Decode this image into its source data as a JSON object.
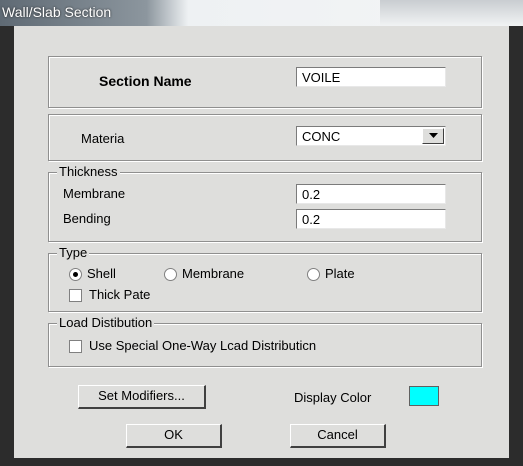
{
  "window": {
    "title": "Wall/Slab Section"
  },
  "section_name": {
    "label": "Section Name",
    "value": "VOILE"
  },
  "material": {
    "label": "Materia",
    "value": "CONC"
  },
  "thickness": {
    "group_label": "Thickness",
    "membrane_label": "Membrane",
    "membrane_value": "0.2",
    "bending_label": "Bending",
    "bending_value": "0.2"
  },
  "type": {
    "group_label": "Type",
    "options": [
      "Shell",
      "Membrane",
      "Plate"
    ],
    "selected": "Shell",
    "thick_plate_label": "Thick Pate",
    "thick_plate_checked": false
  },
  "load_distribution": {
    "group_label": "Load Distibution",
    "special_one_way_label": "Use Special One-Way Lcad Distributicn",
    "checked": false
  },
  "buttons": {
    "set_modifiers": "Set Modifiers...",
    "ok": "OK",
    "cancel": "Cancel"
  },
  "display_color": {
    "label": "Display Color",
    "color": "#00ffff"
  }
}
